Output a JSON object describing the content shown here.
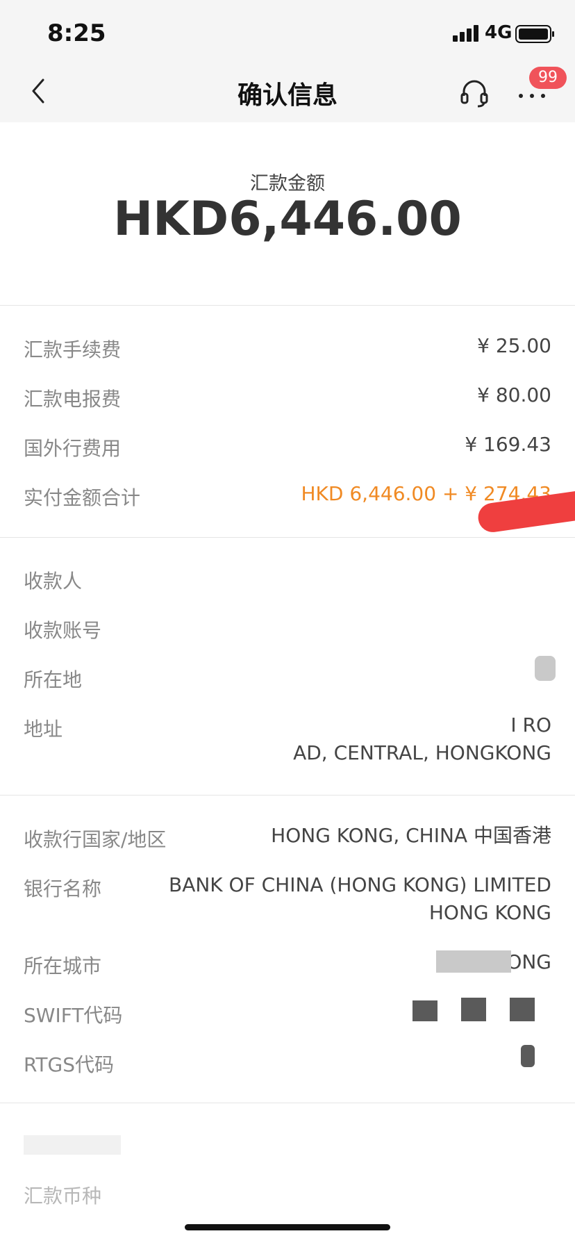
{
  "status": {
    "time": "8:25",
    "network": "4G"
  },
  "nav": {
    "title": "确认信息",
    "badge": "99"
  },
  "amount": {
    "label": "汇款金额",
    "value": "HKD6,446.00"
  },
  "fees": [
    {
      "label": "汇款手续费",
      "value": "¥ 25.00"
    },
    {
      "label": "汇款电报费",
      "value": "¥ 80.00"
    },
    {
      "label": "国外行费用",
      "value": "¥ 169.43"
    },
    {
      "label": "实付金额合计",
      "value": "HKD 6,446.00 + ¥ 274.43"
    }
  ],
  "payee": {
    "name_label": "收款人",
    "account_label": "收款账号",
    "location_label": "所在地",
    "address_label": "地址",
    "address_line1": "I RO",
    "address_line2": "AD, CENTRAL, HONGKONG"
  },
  "bank": {
    "country_label": "收款行国家/地区",
    "country_value": "HONG KONG, CHINA 中国香港",
    "name_label": "银行名称",
    "name_line1": "BANK OF CHINA (HONG KONG) LIMITED",
    "name_line2": "HONG KONG",
    "city_label": "所在城市",
    "city_value": "ONG",
    "swift_label": "SWIFT代码",
    "rtgs_label": "RTGS代码"
  },
  "bottom": {
    "remit_currency_label": "汇款币种"
  },
  "colors": {
    "accent": "#f08a24",
    "badge": "#f0535a",
    "redaction": "#ef3f3f"
  }
}
